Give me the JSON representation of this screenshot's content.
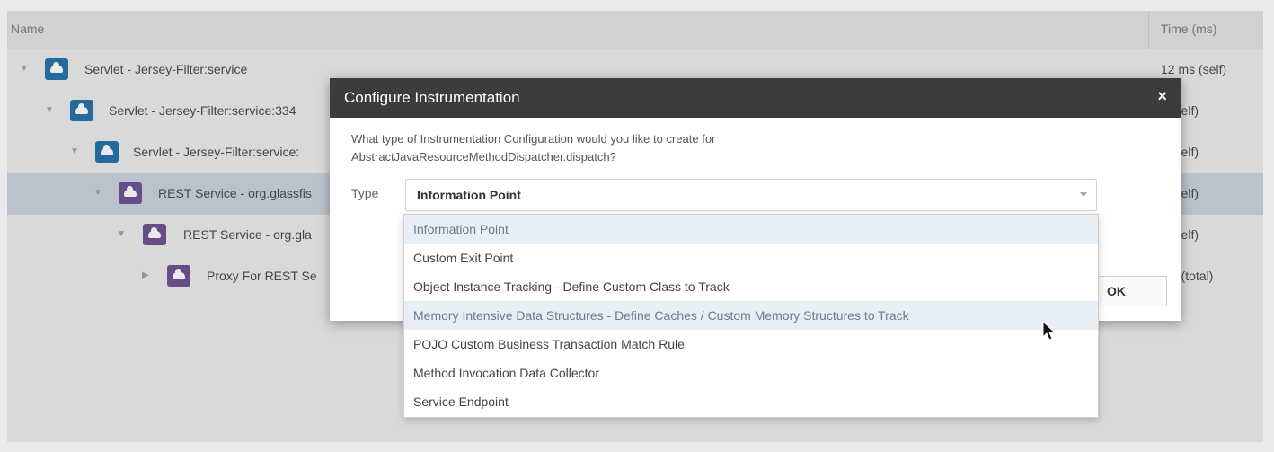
{
  "table": {
    "col_name": "Name",
    "col_time": "Time (ms)",
    "rows": [
      {
        "label": "Servlet - Jersey-Filter:service",
        "time": "12 ms (self)",
        "type": "servlet",
        "expanded": true
      },
      {
        "label": "Servlet - Jersey-Filter:service:334",
        "time": "s (self)",
        "type": "servlet",
        "expanded": true
      },
      {
        "label": "Servlet - Jersey-Filter:service:",
        "time": "s (self)",
        "type": "servlet",
        "expanded": true
      },
      {
        "label": "REST Service - org.glassfis",
        "time": "s (self)",
        "type": "rest",
        "expanded": true,
        "selected": true
      },
      {
        "label": "REST Service - org.gla",
        "time": "s (self)",
        "type": "rest",
        "expanded": true
      },
      {
        "label": "Proxy For REST Se",
        "time": "ms (total)",
        "type": "rest",
        "expanded": false
      }
    ]
  },
  "dialog": {
    "title": "Configure Instrumentation",
    "close_glyph": "×",
    "question_line1": "What type of Instrumentation Configuration would you like to create for",
    "question_line2": "AbstractJavaResourceMethodDispatcher.dispatch?",
    "type_label": "Type",
    "selected_value": "Information Point",
    "ok_label": "OK"
  },
  "dropdown": {
    "options": [
      "Information Point",
      "Custom Exit Point",
      "Object Instance Tracking - Define Custom Class to Track",
      "Memory Intensive Data Structures - Define Caches / Custom Memory Structures to Track",
      "POJO Custom Business Transaction Match Rule",
      "Method Invocation Data Collector",
      "Service Endpoint"
    ],
    "highlighted_indices": [
      0,
      3
    ]
  },
  "icons": {
    "servlet": "cloud-icon",
    "rest": "rest-service-icon",
    "expanded": "triangle-down-icon",
    "collapsed": "triangle-right-icon"
  },
  "colors": {
    "servlet_icon": "#1d6fa8",
    "rest_icon": "#6b4c8f",
    "dialog_title_bg": "#3c3c3c",
    "selected_row": "#c9d3df"
  }
}
